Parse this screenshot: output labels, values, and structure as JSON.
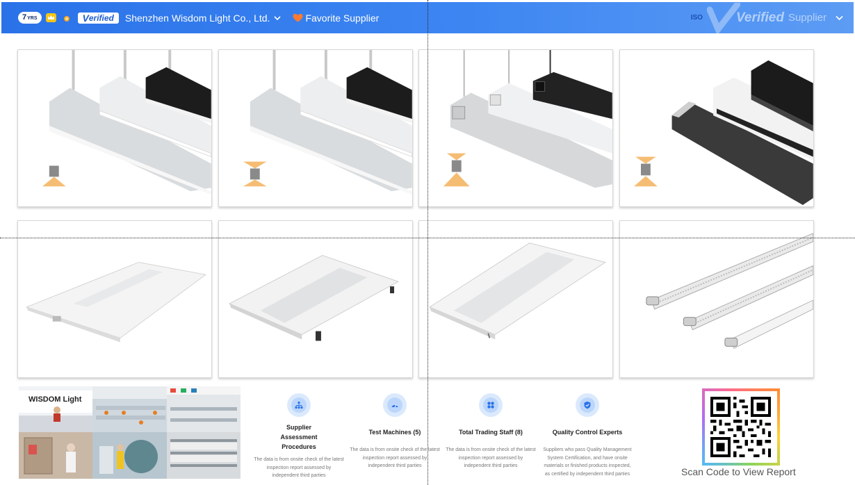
{
  "header": {
    "years": "7",
    "years_suffix": "YRS",
    "verified_label": "erified",
    "company_name": "Shenzhen Wisdom Light Co., Ltd.",
    "favorite_label": "Favorite Supplier",
    "iso_label": "ISO",
    "verified_big": "erified",
    "supplier_label": "Supplier"
  },
  "products": [
    {
      "name": "linear-pendant-light-1"
    },
    {
      "name": "linear-pendant-light-2"
    },
    {
      "name": "linear-pendant-light-3"
    },
    {
      "name": "linear-pendant-light-4"
    },
    {
      "name": "troffer-panel-1"
    },
    {
      "name": "troffer-panel-2"
    },
    {
      "name": "troffer-panel-3"
    },
    {
      "name": "led-tube-batten"
    }
  ],
  "factory": {
    "logo_text": "WISDOM Light"
  },
  "stats": [
    {
      "title": "Supplier Assessment Procedures",
      "desc_lines": [
        "The data is from onsite check of the latest",
        "inspection report assessed by",
        "independent third parties"
      ]
    },
    {
      "title": "Test Machines (5)",
      "desc_lines": [
        "The data is from onsite check of the latest",
        "inspection report assessed by",
        "independent third parties"
      ]
    },
    {
      "title": "Total Trading Staff (8)",
      "desc_lines": [
        "The data is from onsite check of the latest",
        "inspection report assessed by",
        "independent third parties"
      ]
    },
    {
      "title": "Quality Control Experts",
      "desc_lines": [
        "Suppliers who pass Quality Management",
        "System Certification, and have onsite",
        "materials or finished products inspected,",
        "as certified by independent third parties"
      ]
    }
  ],
  "qr": {
    "scan_label": "Scan Code to View Report"
  },
  "colors": {
    "header_blue": "#2a72e8",
    "accent_orange": "#ff7a2f"
  }
}
